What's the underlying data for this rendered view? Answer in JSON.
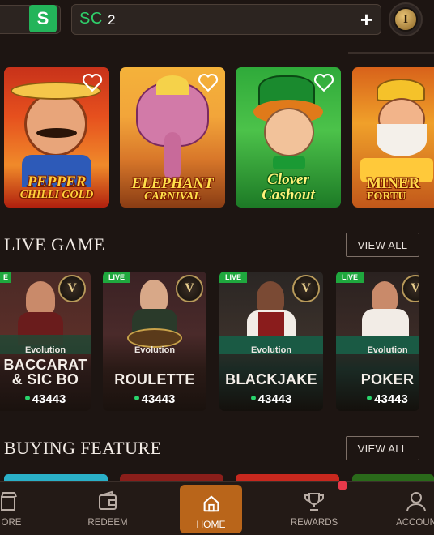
{
  "header": {
    "s_badge": "S",
    "currency_label": "SC",
    "currency_value": "2",
    "add_symbol": "+",
    "avatar_letter": "I"
  },
  "slots": [
    {
      "title_line1": "PEPPER",
      "title_line2": "CHILLI GOLD"
    },
    {
      "title_line1": "ELEPHANT",
      "title_line2": "CARNIVAL"
    },
    {
      "title_line1": "Clover",
      "title_line2": "Cashout"
    },
    {
      "title_line1": "MINER",
      "title_line2": "FORTU"
    }
  ],
  "live_section": {
    "title": "LIVE GAME",
    "view_all": "VIEW ALL",
    "games": [
      {
        "badge": "E",
        "provider": "Evolution",
        "name_line1": "BACCARAT",
        "name_line2": "& SIC BO",
        "players": "43443"
      },
      {
        "badge": "LIVE",
        "provider": "Evolution",
        "name_line1": "ROULETTE",
        "name_line2": "",
        "players": "43443"
      },
      {
        "badge": "LIVE",
        "provider": "Evolution",
        "name_line1": "BLACKJAKE",
        "name_line2": "",
        "players": "43443"
      },
      {
        "badge": "LIVE",
        "provider": "Evolution",
        "name_line1": "POKER",
        "name_line2": "",
        "players": "43443"
      }
    ]
  },
  "buying_section": {
    "title": "BUYING FEATURE",
    "view_all": "VIEW ALL"
  },
  "nav": {
    "store": "ORE",
    "redeem": "REDEEM",
    "home": "HOME",
    "rewards": "REWARDS",
    "account": "ACCOUN"
  },
  "colors": {
    "background": "#1d1512",
    "accent_green": "#2fd06b",
    "home_active": "#b9651a",
    "live_badge": "#1fa83e",
    "notification": "#e8394a"
  }
}
